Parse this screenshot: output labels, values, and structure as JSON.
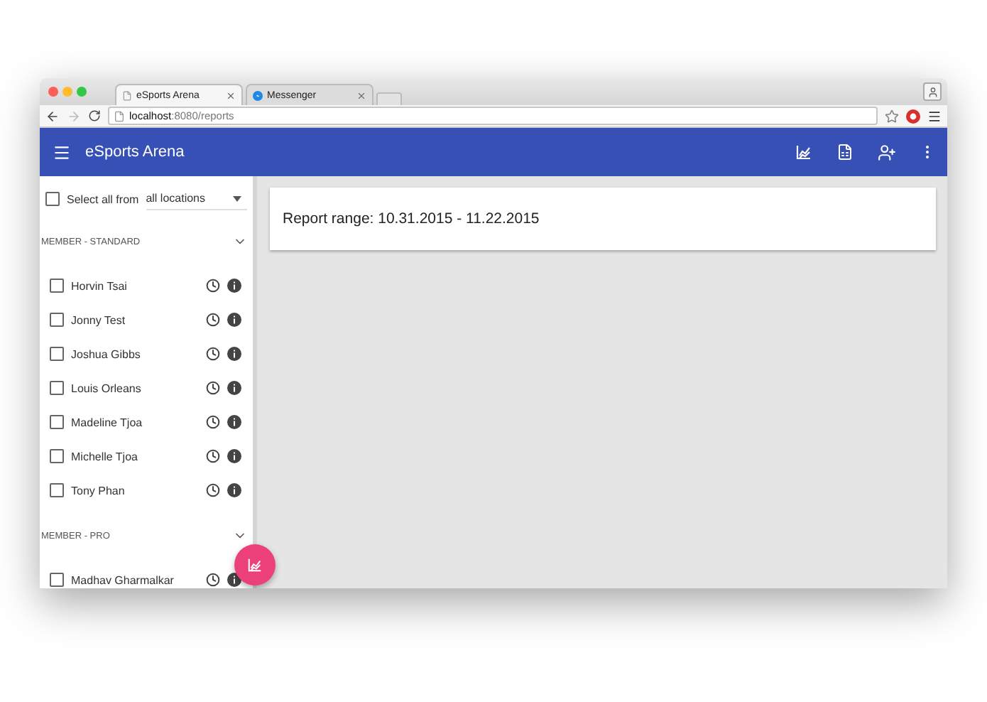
{
  "browser": {
    "tabs": [
      {
        "title": "eSports Arena",
        "selected": true,
        "kind": "blank"
      },
      {
        "title": "Messenger",
        "selected": false,
        "kind": "messenger"
      }
    ],
    "url_host": "localhost",
    "url_path": ":8080/reports"
  },
  "app_bar": {
    "title": "eSports Arena"
  },
  "sidebar": {
    "select_all": {
      "label": "Select all from",
      "checked": false
    },
    "location": "all locations",
    "groups": [
      {
        "title": "MEMBER - STANDARD",
        "expanded": true,
        "members": [
          {
            "name": "Horvin Tsai",
            "checked": false
          },
          {
            "name": "Jonny Test",
            "checked": false
          },
          {
            "name": "Joshua Gibbs",
            "checked": false
          },
          {
            "name": "Louis Orleans",
            "checked": false
          },
          {
            "name": "Madeline Tjoa",
            "checked": false
          },
          {
            "name": "Michelle Tjoa",
            "checked": false
          },
          {
            "name": "Tony Phan",
            "checked": false
          }
        ]
      },
      {
        "title": "MEMBER - PRO",
        "expanded": true,
        "members": [
          {
            "name": "Madhav Gharmalkar",
            "checked": false
          }
        ]
      }
    ]
  },
  "report": {
    "range": "Report range: 10.31.2015 - 11.22.2015"
  }
}
